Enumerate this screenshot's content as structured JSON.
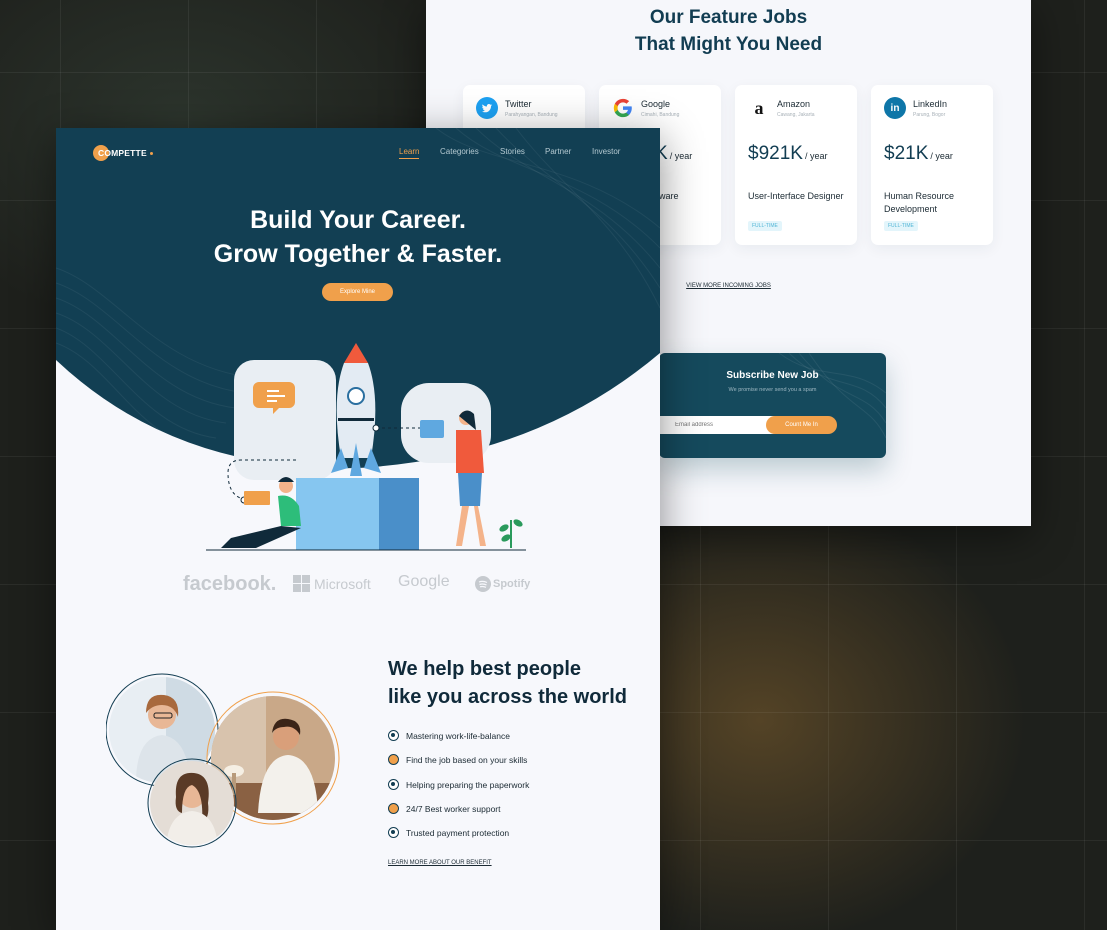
{
  "colors": {
    "primary": "#154a5d",
    "accent": "#f0a04b",
    "text": "#102a3a"
  },
  "back": {
    "title_line1": "Our Feature Jobs",
    "title_line2": "That Might You Need",
    "jobs": [
      {
        "company": "Twitter",
        "location": "Parahyangan, Bandung",
        "salary": "",
        "per": "",
        "role": "",
        "badge": "",
        "icon": "twitter-icon"
      },
      {
        "company": "Google",
        "location": "Cimahi, Bandung",
        "salary": "K",
        "per": "/ year",
        "role": "ware",
        "badge": "",
        "icon": "google-icon"
      },
      {
        "company": "Amazon",
        "location": "Cawang, Jakarta",
        "salary": "$921K",
        "per": "/ year",
        "role": "User-Interface Designer",
        "badge": "FULL-TIME",
        "icon": "amazon-icon"
      },
      {
        "company": "LinkedIn",
        "location": "Parung, Bogor",
        "salary": "$21K",
        "per": "/ year",
        "role": "Human Resource Development",
        "badge": "FULL-TIME",
        "icon": "linkedin-icon"
      }
    ],
    "view_more": "VIEW MORE INCOMING JOBS",
    "subscribe": {
      "title": "Subscribe New Job",
      "subtitle": "We promise never send you a spam",
      "placeholder": "Email address",
      "button": "Count Me In"
    }
  },
  "front": {
    "logo_text": "COMPETTE",
    "nav": [
      "Learn",
      "Categories",
      "Stories",
      "Partner",
      "Investor"
    ],
    "hero_line1": "Build Your Career.",
    "hero_line2": "Grow Together & Faster.",
    "hero_button": "Explore Mine",
    "brands": [
      "facebook.",
      "Microsoft",
      "Google",
      "Spotify"
    ],
    "help_line1": "We help best people",
    "help_line2": "like you across the world",
    "benefits": [
      "Mastering work-life-balance",
      "Find the job based on your skills",
      "Helping preparing the paperwork",
      "24/7 Best worker support",
      "Trusted payment protection"
    ],
    "learn_more": "LEARN MORE ABOUT OUR BENEFIT"
  }
}
